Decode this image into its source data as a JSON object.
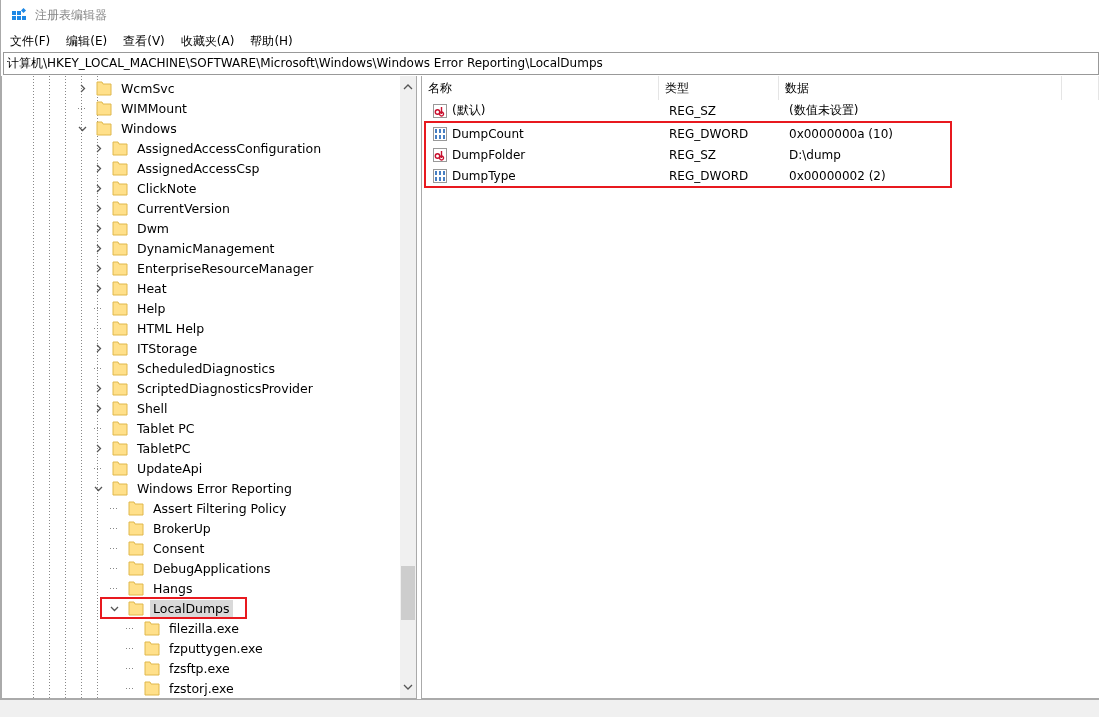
{
  "window": {
    "title": "注册表编辑器"
  },
  "menu": [
    "文件(F)",
    "编辑(E)",
    "查看(V)",
    "收藏夹(A)",
    "帮助(H)"
  ],
  "address": "计算机\\HKEY_LOCAL_MACHINE\\SOFTWARE\\Microsoft\\Windows\\Windows Error Reporting\\LocalDumps",
  "tree": [
    {
      "name": "WcmSvc",
      "kind": "branch",
      "expanded": false,
      "selected": false,
      "highlighted": false
    },
    {
      "name": "WIMMount",
      "kind": "leaf",
      "selected": false,
      "highlighted": false
    },
    {
      "name": "Windows",
      "kind": "branch",
      "expanded": true,
      "selected": false,
      "highlighted": false,
      "children": [
        {
          "name": "AssignedAccessConfiguration",
          "kind": "branch",
          "expanded": false,
          "selected": false,
          "highlighted": false
        },
        {
          "name": "AssignedAccessCsp",
          "kind": "branch",
          "expanded": false,
          "selected": false,
          "highlighted": false
        },
        {
          "name": "ClickNote",
          "kind": "branch",
          "expanded": false,
          "selected": false,
          "highlighted": false
        },
        {
          "name": "CurrentVersion",
          "kind": "branch",
          "expanded": false,
          "selected": false,
          "highlighted": false
        },
        {
          "name": "Dwm",
          "kind": "branch",
          "expanded": false,
          "selected": false,
          "highlighted": false
        },
        {
          "name": "DynamicManagement",
          "kind": "branch",
          "expanded": false,
          "selected": false,
          "highlighted": false
        },
        {
          "name": "EnterpriseResourceManager",
          "kind": "branch",
          "expanded": false,
          "selected": false,
          "highlighted": false
        },
        {
          "name": "Heat",
          "kind": "branch",
          "expanded": false,
          "selected": false,
          "highlighted": false
        },
        {
          "name": "Help",
          "kind": "leaf",
          "selected": false,
          "highlighted": false
        },
        {
          "name": "HTML Help",
          "kind": "leaf",
          "selected": false,
          "highlighted": false
        },
        {
          "name": "ITStorage",
          "kind": "branch",
          "expanded": false,
          "selected": false,
          "highlighted": false
        },
        {
          "name": "ScheduledDiagnostics",
          "kind": "leaf",
          "selected": false,
          "highlighted": false
        },
        {
          "name": "ScriptedDiagnosticsProvider",
          "kind": "branch",
          "expanded": false,
          "selected": false,
          "highlighted": false
        },
        {
          "name": "Shell",
          "kind": "branch",
          "expanded": false,
          "selected": false,
          "highlighted": false
        },
        {
          "name": "Tablet PC",
          "kind": "leaf",
          "selected": false,
          "highlighted": false
        },
        {
          "name": "TabletPC",
          "kind": "branch",
          "expanded": false,
          "selected": false,
          "highlighted": false
        },
        {
          "name": "UpdateApi",
          "kind": "leaf",
          "selected": false,
          "highlighted": false
        },
        {
          "name": "Windows Error Reporting",
          "kind": "branch",
          "expanded": true,
          "selected": false,
          "highlighted": false,
          "children": [
            {
              "name": "Assert Filtering Policy",
              "kind": "leaf",
              "selected": false,
              "highlighted": false
            },
            {
              "name": "BrokerUp",
              "kind": "leaf",
              "selected": false,
              "highlighted": false
            },
            {
              "name": "Consent",
              "kind": "leaf",
              "selected": false,
              "highlighted": false
            },
            {
              "name": "DebugApplications",
              "kind": "leaf",
              "selected": false,
              "highlighted": false
            },
            {
              "name": "Hangs",
              "kind": "leaf",
              "selected": false,
              "highlighted": false
            },
            {
              "name": "LocalDumps",
              "kind": "branch",
              "expanded": true,
              "selected": true,
              "highlighted": true,
              "children": [
                {
                  "name": "filezilla.exe",
                  "kind": "leaf",
                  "selected": false,
                  "highlighted": false
                },
                {
                  "name": "fzputtygen.exe",
                  "kind": "leaf",
                  "selected": false,
                  "highlighted": false
                },
                {
                  "name": "fzsftp.exe",
                  "kind": "leaf",
                  "selected": false,
                  "highlighted": false
                },
                {
                  "name": "fzstorj.exe",
                  "kind": "leaf",
                  "selected": false,
                  "highlighted": false
                }
              ]
            }
          ]
        }
      ]
    }
  ],
  "values": {
    "columns": [
      "名称",
      "类型",
      "数据"
    ],
    "rows": [
      {
        "kind": "string",
        "name": "(默认)",
        "type": "REG_SZ",
        "data": "(数值未设置)",
        "highlighted": false
      },
      {
        "kind": "dword",
        "name": "DumpCount",
        "type": "REG_DWORD",
        "data": "0x0000000a (10)",
        "highlighted": true
      },
      {
        "kind": "string",
        "name": "DumpFolder",
        "type": "REG_SZ",
        "data": "D:\\dump",
        "highlighted": true
      },
      {
        "kind": "dword",
        "name": "DumpType",
        "type": "REG_DWORD",
        "data": "0x00000002 (2)",
        "highlighted": true
      }
    ]
  }
}
